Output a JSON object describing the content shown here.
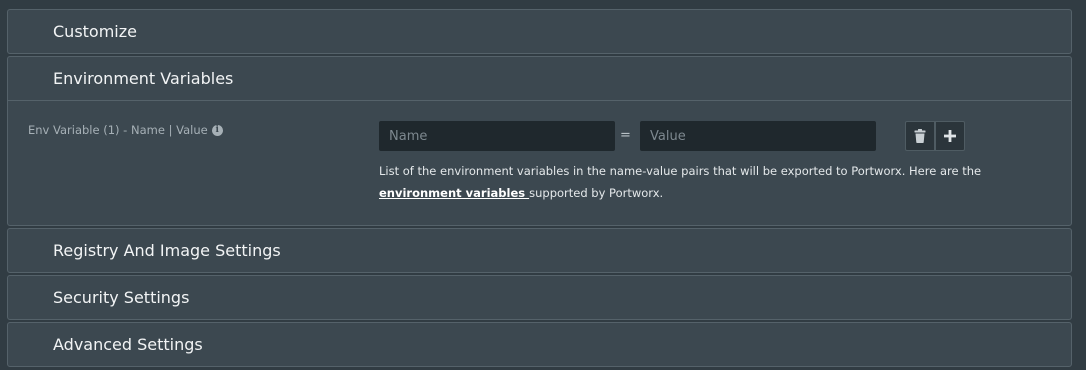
{
  "sections": {
    "customize": "Customize",
    "environment_variables": "Environment Variables",
    "registry": "Registry And Image Settings",
    "security": "Security Settings",
    "advanced": "Advanced Settings"
  },
  "env": {
    "field_label": "Env Variable (1) - Name | Value",
    "info_icon": "i",
    "name_placeholder": "Name",
    "equals": "=",
    "value_placeholder": "Value",
    "help_prefix": "List of the environment variables in the name-value pairs that will be exported to Portworx. Here are the ",
    "help_link": "environment variables ",
    "help_suffix": "supported by Portworx.",
    "delete_icon": "trash-icon",
    "add_icon": "plus-icon"
  }
}
